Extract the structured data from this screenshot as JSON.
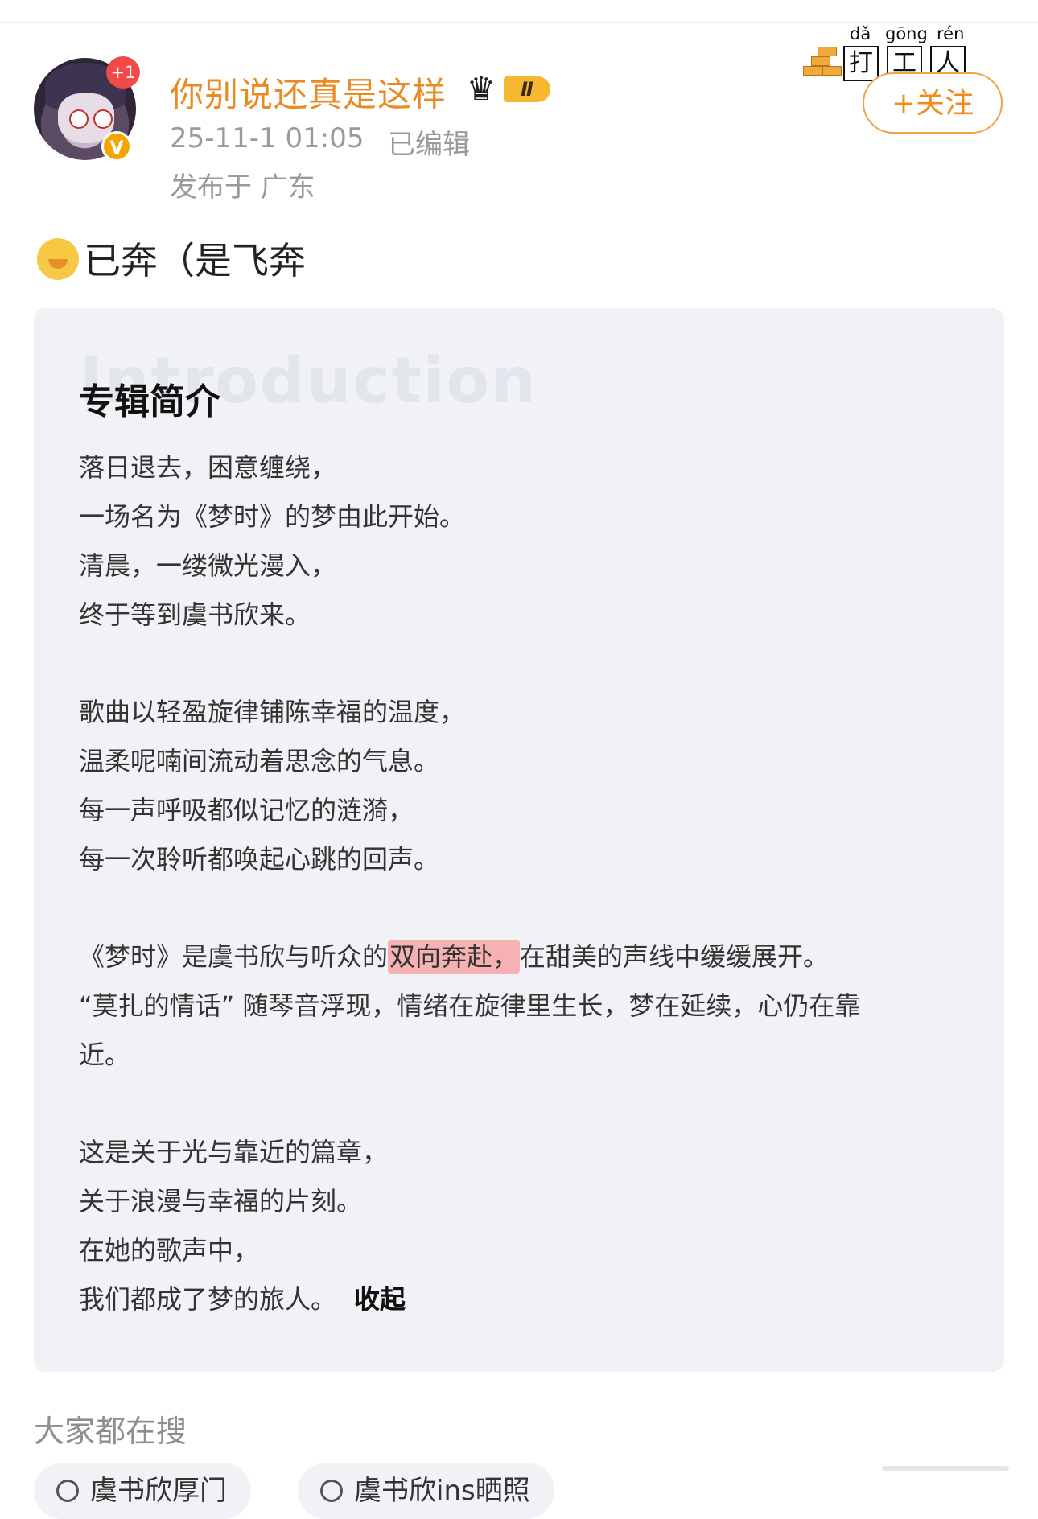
{
  "post": {
    "username": "你别说还真是这样",
    "vip_level": "Ⅱ",
    "timestamp": "25-11-1 01:05",
    "edited": "已编辑",
    "location": "发布于 广东",
    "avatar_badge": "+1",
    "verified_badge": "V",
    "follow_label": "+关注",
    "text": "已奔（是飞奔",
    "sticker": {
      "pinyin": [
        "dǎ",
        "gōng",
        "rén"
      ],
      "chars": [
        "打",
        "工",
        "人"
      ]
    }
  },
  "card": {
    "watermark": "Introduction",
    "title": "专辑简介",
    "p1": [
      "落日退去，困意缠绕，",
      "一场名为《梦时》的梦由此开始。",
      "清晨，一缕微光漫入，",
      "终于等到虞书欣来。"
    ],
    "p2": [
      "歌曲以轻盈旋律铺陈幸福的温度，",
      "温柔呢喃间流动着思念的气息。",
      "每一声呼吸都似记忆的涟漪，",
      "每一次聆听都唤起心跳的回声。"
    ],
    "p3_before": "《梦时》是虞书欣与听众的",
    "p3_highlight": "双向奔赴，",
    "p3_after": "在甜美的声线中缓缓展开。",
    "p3_line2": "“莫扎的情话” 随琴音浮现，情绪在旋律里生长，梦在延续，心仍在靠",
    "p3_line3": "近。",
    "p4": [
      "这是关于光与靠近的篇章，",
      "关于浪漫与幸福的片刻。",
      "在她的歌声中，"
    ],
    "p4_last": "我们都成了梦的旅人。",
    "collapse_label": "收起"
  },
  "hot_search": {
    "title": "大家都在搜",
    "chips": [
      "虞书欣厚门",
      "虞书欣ins晒照"
    ]
  }
}
